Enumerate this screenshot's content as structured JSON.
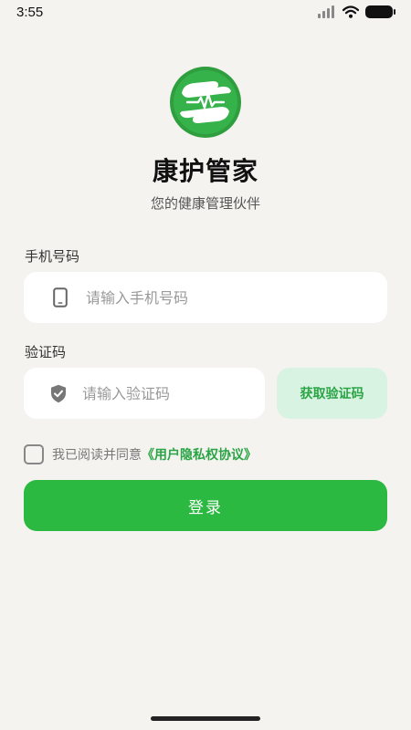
{
  "status_bar": {
    "time": "3:55",
    "icons": [
      "signal-icon",
      "wifi-icon",
      "battery-icon"
    ]
  },
  "app": {
    "logo_icon": "hands-heartbeat-logo",
    "name": "康护管家",
    "tagline": "您的健康管理伙伴"
  },
  "form": {
    "phone": {
      "label": "手机号码",
      "icon": "phone-icon",
      "value": "",
      "placeholder": "请输入手机号码"
    },
    "code": {
      "label": "验证码",
      "icon": "shield-check-icon",
      "value": "",
      "placeholder": "请输入验证码",
      "get_code_label": "获取验证码"
    },
    "agreement": {
      "checked": false,
      "text": "我已阅读并同意",
      "link_text": "《用户隐私权协议》"
    },
    "login_label": "登录"
  },
  "colors": {
    "background": "#f4f3f0",
    "primary": "#2bb942",
    "primary_light": "#d9f3e3",
    "link": "#2aa444"
  }
}
